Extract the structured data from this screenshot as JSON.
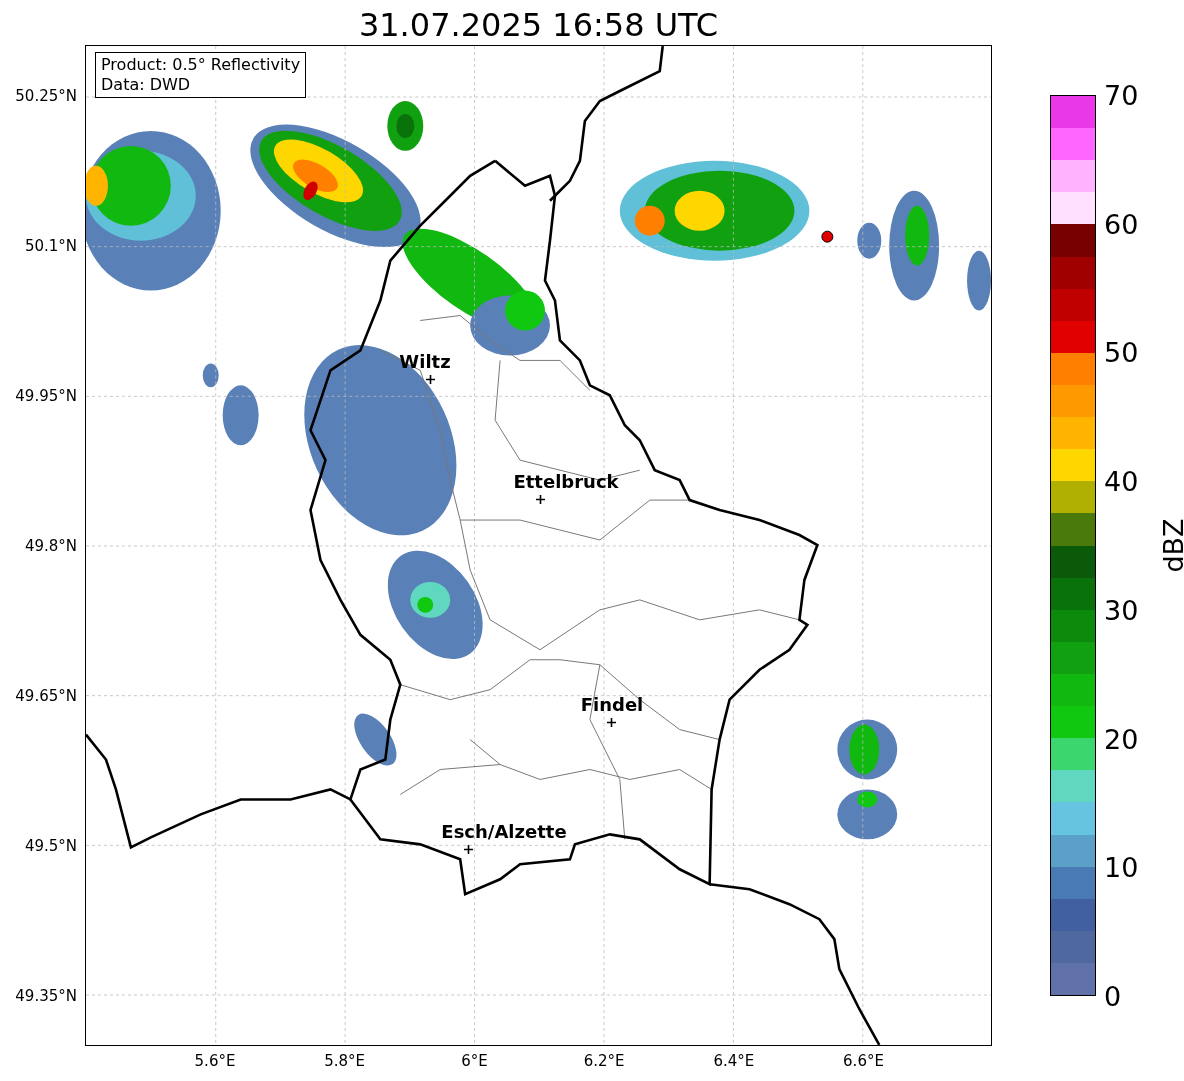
{
  "title": "31.07.2025 16:58 UTC",
  "info_box": {
    "lines": [
      "Product: 0.5° Reflectivity",
      "Data: DWD"
    ]
  },
  "map": {
    "cities": [
      {
        "name": "Wiltz"
      },
      {
        "name": "Ettelbruck"
      },
      {
        "name": "Findel"
      },
      {
        "name": "Esch/Alzette"
      }
    ],
    "y_ticks": [
      "50.25°N",
      "50.1°N",
      "49.95°N",
      "49.8°N",
      "49.65°N",
      "49.5°N",
      "49.35°N"
    ],
    "x_ticks": [
      "5.6°E",
      "5.8°E",
      "6°E",
      "6.2°E",
      "6.4°E",
      "6.6°E"
    ]
  },
  "colorbar": {
    "label": "dBZ",
    "ticks": [
      "70",
      "60",
      "50",
      "40",
      "30",
      "20",
      "10",
      "0"
    ],
    "bands": [
      {
        "color": "#e838e8"
      },
      {
        "color": "#ff66ff"
      },
      {
        "color": "#ffb3ff"
      },
      {
        "color": "#ffe0ff"
      },
      {
        "color": "#780000"
      },
      {
        "color": "#a00000"
      },
      {
        "color": "#c00000"
      },
      {
        "color": "#e00000"
      },
      {
        "color": "#ff8000"
      },
      {
        "color": "#ff9900"
      },
      {
        "color": "#ffb400"
      },
      {
        "color": "#ffd700"
      },
      {
        "color": "#b0b000"
      },
      {
        "color": "#4a7a0a"
      },
      {
        "color": "#0a5a0a"
      },
      {
        "color": "#0a720a"
      },
      {
        "color": "#0c8a0c"
      },
      {
        "color": "#10a010"
      },
      {
        "color": "#10b810"
      },
      {
        "color": "#10c810"
      },
      {
        "color": "#3cd66e"
      },
      {
        "color": "#60d8c0"
      },
      {
        "color": "#66c4e0"
      },
      {
        "color": "#5aa0c8"
      },
      {
        "color": "#4a7ab4"
      },
      {
        "color": "#4060a0"
      },
      {
        "color": "#5068a0"
      },
      {
        "color": "#6070a8"
      }
    ]
  }
}
